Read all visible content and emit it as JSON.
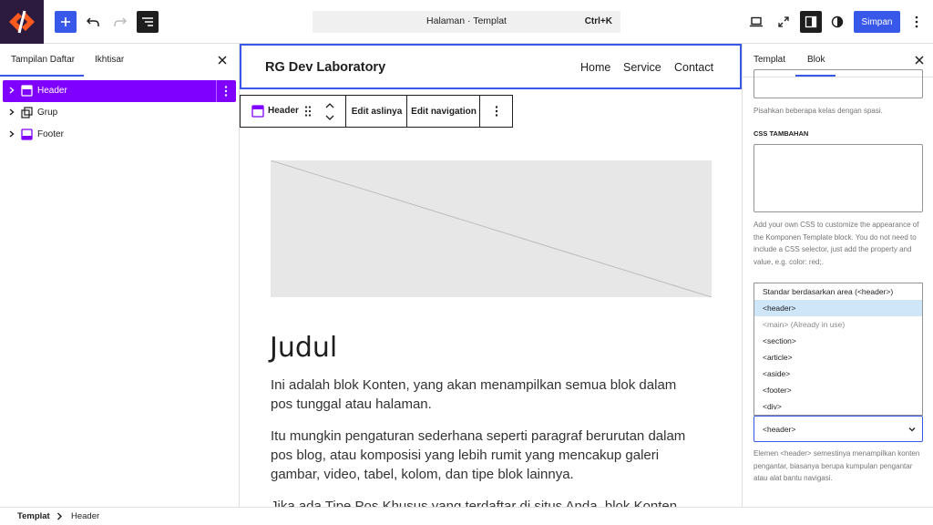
{
  "topbar": {
    "document_title": "Halaman · Templat",
    "shortcut": "Ctrl+K",
    "save_label": "Simpan"
  },
  "left_panel": {
    "tabs": [
      "Tampilan Daftar",
      "Ikhtisar"
    ],
    "tree": [
      {
        "label": "Header",
        "selected": true
      },
      {
        "label": "Grup",
        "selected": false
      },
      {
        "label": "Footer",
        "selected": false
      }
    ]
  },
  "canvas": {
    "site_title": "RG Dev Laboratory",
    "nav": [
      "Home",
      "Service",
      "Contact"
    ],
    "toolbar": {
      "block_label": "Header",
      "edit_original": "Edit aslinya",
      "edit_navigation": "Edit navigation"
    },
    "post_title": "Judul",
    "paragraphs": [
      "Ini adalah blok Konten, yang akan menampilkan semua blok dalam pos tunggal atau halaman.",
      "Itu mungkin pengaturan sederhana seperti paragraf berurutan dalam pos blog, atau komposisi yang lebih rumit yang mencakup galeri gambar, video, tabel, kolom, dan tipe blok lainnya.",
      "Jika ada Tipe Pos Khusus yang terdaftar di situs Anda, blok Konten juga"
    ]
  },
  "right_panel": {
    "tabs": [
      "Templat",
      "Blok"
    ],
    "css_class_help": "Pisahkan beberapa kelas dengan spasi.",
    "extra_css_label": "CSS TAMBAHAN",
    "extra_css_help": "Add your own CSS to customize the appearance of the Komponen Template block. You do not need to include a CSS selector, just add the property and value, e.g. color: red;.",
    "tag_options": [
      {
        "label": "Standar berdasarkan area (<header>)",
        "state": "normal"
      },
      {
        "label": "<header>",
        "state": "selected"
      },
      {
        "label": "<main> (Already in use)",
        "state": "disabled"
      },
      {
        "label": "<section>",
        "state": "normal"
      },
      {
        "label": "<article>",
        "state": "normal"
      },
      {
        "label": "<aside>",
        "state": "normal"
      },
      {
        "label": "<footer>",
        "state": "normal"
      },
      {
        "label": "<div>",
        "state": "normal"
      }
    ],
    "tag_selected": "<header>",
    "tag_help": "Elemen <header> semestinya menampilkan konten pengantar, biasanya berupa kumpulan pengantar atau alat bantu navigasi."
  },
  "breadcrumb": [
    "Templat",
    "Header"
  ],
  "colors": {
    "accent": "#3858e9",
    "selection": "#8000ff",
    "logo_bg": "#2d1a3f",
    "logo_mark": "#ff5a1f"
  },
  "icons": [
    "logo-icon",
    "plus-icon",
    "undo-icon",
    "redo-icon",
    "document-overview-icon",
    "desktop-preview-icon",
    "external-view-icon",
    "settings-sidebar-icon",
    "styles-icon",
    "more-options-icon",
    "close-icon",
    "chevron-right-icon",
    "template-part-icon",
    "group-icon",
    "footer-icon",
    "drag-handle-icon",
    "chevron-up-icon",
    "chevron-down-icon"
  ]
}
